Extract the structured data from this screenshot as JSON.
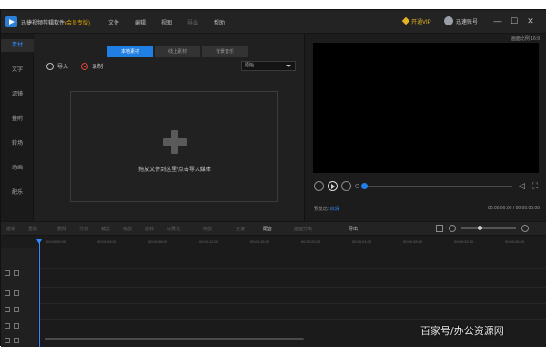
{
  "window": {
    "title": "迅捷视频剪辑软件",
    "edition": "(会员专版)",
    "menu": [
      "文件",
      "编辑",
      "视图",
      "导出",
      "帮助"
    ],
    "vip_label": "开通VIP",
    "username": "迅速账号",
    "controls": [
      "—",
      "☐",
      "✕"
    ]
  },
  "sidebar": {
    "items": [
      {
        "label": "素材",
        "active": true
      },
      {
        "label": "文字",
        "active": false
      },
      {
        "label": "滤镜",
        "active": false
      },
      {
        "label": "叠附",
        "active": false
      },
      {
        "label": "转场",
        "active": false
      },
      {
        "label": "动画",
        "active": false
      },
      {
        "label": "配乐",
        "active": false
      }
    ]
  },
  "media": {
    "tabs": [
      {
        "label": "本地素材",
        "active": true
      },
      {
        "label": "线上素材",
        "active": false
      },
      {
        "label": "背景音乐",
        "active": false
      }
    ],
    "import_label": "导入",
    "record_label": "录制",
    "sort_value": "原始",
    "drop_hint": "拖放文件到这里/点击导入媒体"
  },
  "preview": {
    "aspect": "画面比例 16:9",
    "quality_label": "预览比:",
    "quality_value": "标清",
    "timecode": "00:00:00.00 / 00:00:00.00",
    "progress": 0.0
  },
  "toolbar": {
    "tools": [
      "撤销",
      "重做",
      "删除",
      "分割",
      "裁剪",
      "缩放",
      "旋转",
      "马赛克",
      "倒放",
      "变速",
      "配音",
      "画面分离",
      "导出"
    ],
    "active_tool": "配音"
  },
  "timeline": {
    "ticks": [
      "00:00:00.00",
      "00:00:04.00",
      "00:00:08.00",
      "00:00:12.00",
      "00:00:16.00",
      "00:00:20.00",
      "00:00:24.00",
      "00:00:28.00",
      "00:00:32.00",
      "00:00:36.00"
    ]
  },
  "watermark": "百家号/办公资源网"
}
